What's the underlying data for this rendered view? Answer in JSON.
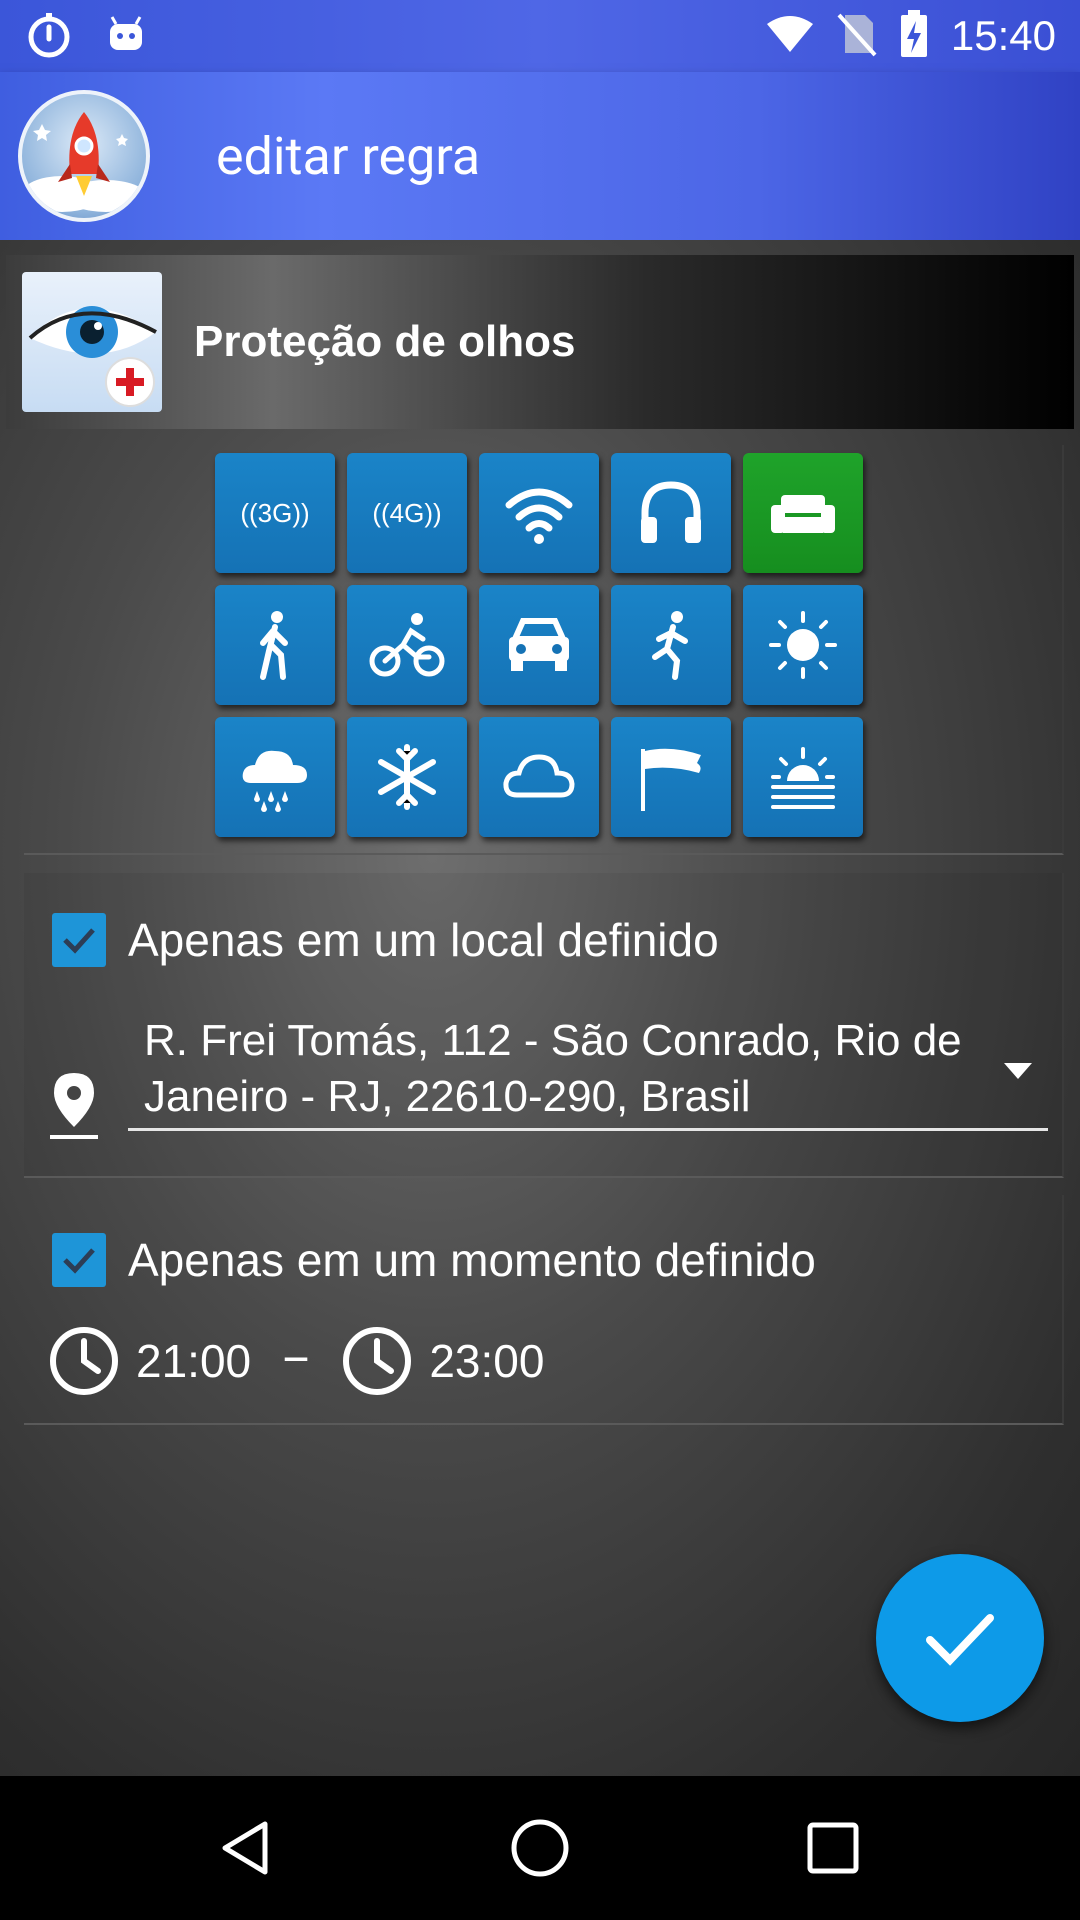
{
  "status_bar": {
    "time": "15:40",
    "icons": [
      "stopwatch-icon",
      "android-icon",
      "wifi-icon",
      "no-sim-icon",
      "battery-charging-icon"
    ]
  },
  "app_bar": {
    "title": "editar regra",
    "logo": "rocket-logo"
  },
  "rule": {
    "name": "Proteção de olhos",
    "icon": "eye-protection-icon"
  },
  "condition_tiles": [
    {
      "name": "3g",
      "label": "((3G))",
      "active": false
    },
    {
      "name": "4g",
      "label": "((4G))",
      "active": false
    },
    {
      "name": "wifi",
      "label": "",
      "active": false
    },
    {
      "name": "headphones",
      "label": "",
      "active": false
    },
    {
      "name": "sofa",
      "label": "",
      "active": true
    },
    {
      "name": "walking",
      "label": "",
      "active": false
    },
    {
      "name": "cycling",
      "label": "",
      "active": false
    },
    {
      "name": "car",
      "label": "",
      "active": false
    },
    {
      "name": "running",
      "label": "",
      "active": false
    },
    {
      "name": "sunny",
      "label": "",
      "active": false
    },
    {
      "name": "rain",
      "label": "",
      "active": false
    },
    {
      "name": "snow",
      "label": "",
      "active": false
    },
    {
      "name": "cloud",
      "label": "",
      "active": false
    },
    {
      "name": "wind",
      "label": "",
      "active": false
    },
    {
      "name": "sunrise",
      "label": "",
      "active": false
    }
  ],
  "location": {
    "checkbox_label": "Apenas em um local definido",
    "checked": true,
    "address": "R. Frei Tomás, 112 - São Conrado, Rio de Janeiro - RJ, 22610-290, Brasil"
  },
  "time": {
    "checkbox_label": "Apenas em um momento definido",
    "checked": true,
    "start": "21:00",
    "separator": "–",
    "end": "23:00"
  },
  "colors": {
    "accent": "#1e95d8",
    "tile": "#1572b5",
    "tile_active": "#1a9a24",
    "fab": "#0d9ae8"
  }
}
